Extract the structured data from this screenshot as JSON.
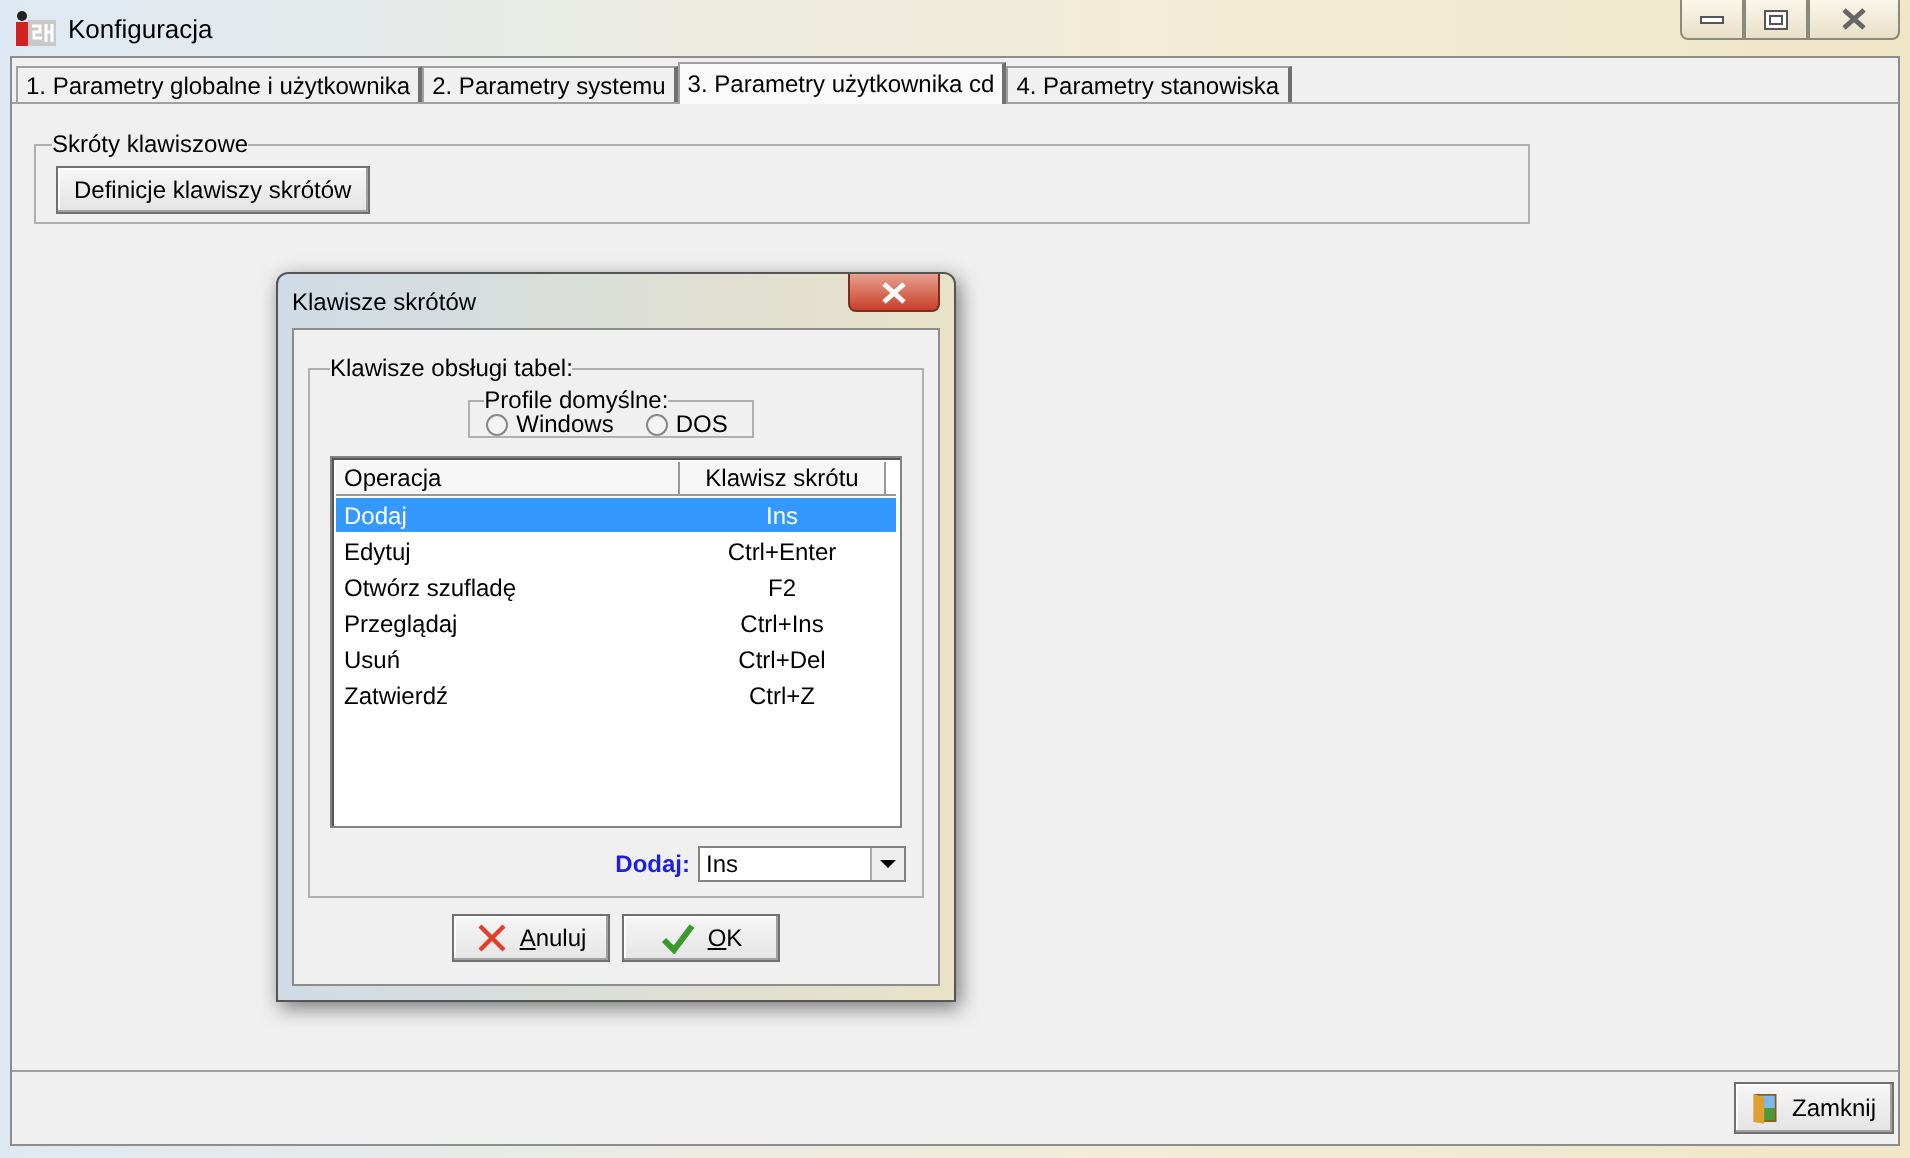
{
  "window": {
    "title": "Konfiguracja"
  },
  "tabs": [
    {
      "label": "1. Parametry globalne i użytkownika",
      "selected": false
    },
    {
      "label": "2. Parametry systemu",
      "selected": false
    },
    {
      "label": "3. Parametry użytkownika cd",
      "selected": true
    },
    {
      "label": "4. Parametry stanowiska",
      "selected": false
    }
  ],
  "group": {
    "title": "Skróty klawiszowe",
    "button": "Definicje klawiszy skrótów"
  },
  "dialog": {
    "title": "Klawisze skrótów",
    "group_title": "Klawisze obsługi tabel:",
    "profiles": {
      "title": "Profile domyślne:",
      "options": [
        {
          "label": "Windows",
          "selected": false
        },
        {
          "label": "DOS",
          "selected": false
        }
      ]
    },
    "table": {
      "columns": [
        "Operacja",
        "Klawisz skrótu"
      ],
      "rows": [
        {
          "operation": "Dodaj",
          "key": "Ins",
          "selected": true
        },
        {
          "operation": "Edytuj",
          "key": "Ctrl+Enter",
          "selected": false
        },
        {
          "operation": "Otwórz szufladę",
          "key": "F2",
          "selected": false
        },
        {
          "operation": "Przeglądaj",
          "key": "Ctrl+Ins",
          "selected": false
        },
        {
          "operation": "Usuń",
          "key": "Ctrl+Del",
          "selected": false
        },
        {
          "operation": "Zatwierdź",
          "key": "Ctrl+Z",
          "selected": false
        }
      ]
    },
    "editor": {
      "label": "Dodaj:",
      "value": "Ins"
    },
    "buttons": [
      {
        "label": "Anuluj",
        "kind": "cancel"
      },
      {
        "label": "OK",
        "kind": "ok"
      }
    ]
  },
  "footer": {
    "button": "Zamknij"
  }
}
